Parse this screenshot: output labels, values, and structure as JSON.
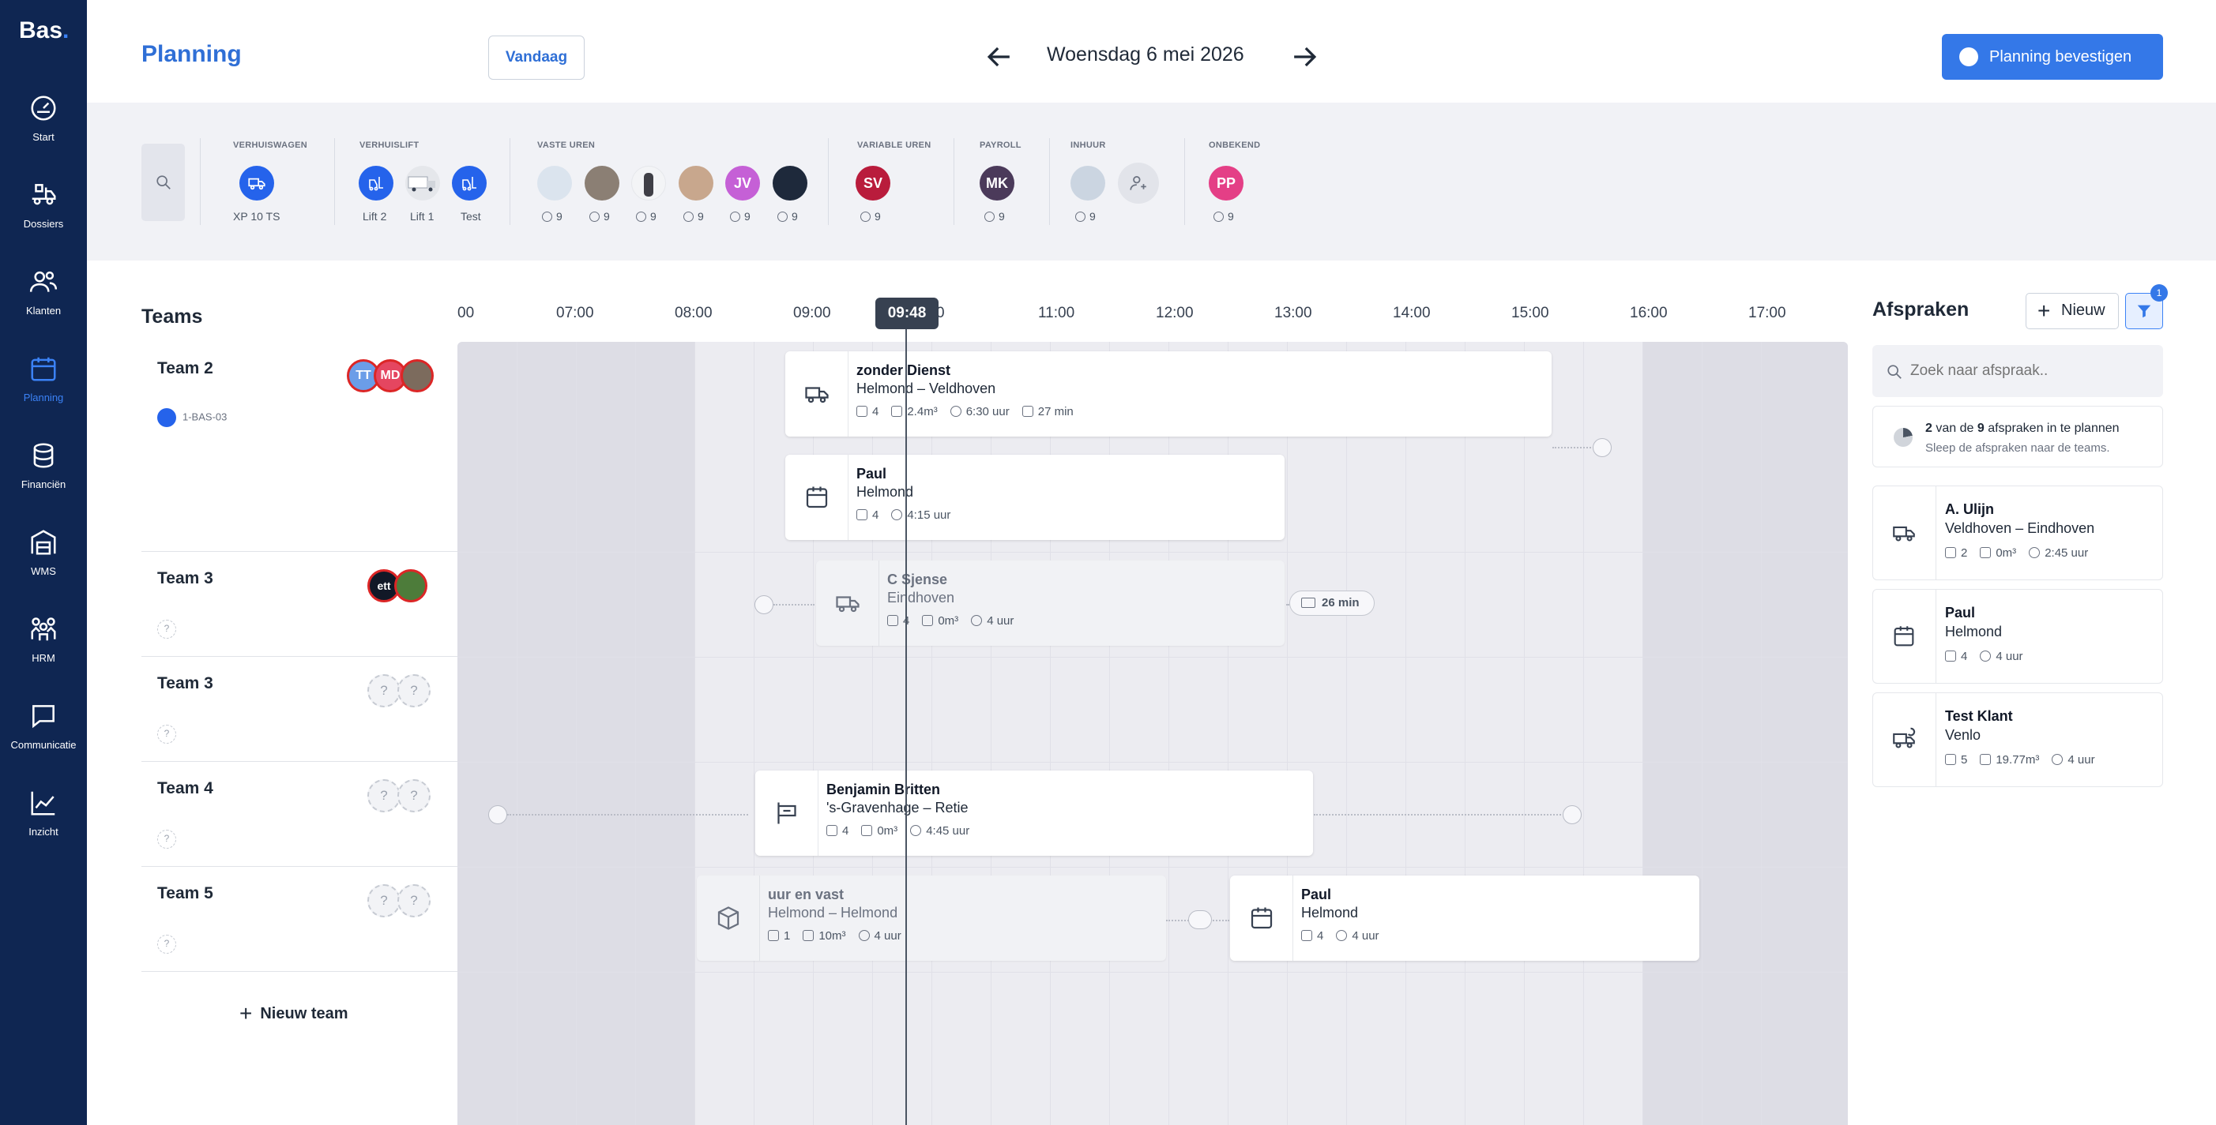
{
  "app": {
    "logo": "Bas",
    "logo_dot": "."
  },
  "sidebar": {
    "items": [
      {
        "label": "Start",
        "icon": "gauge-icon"
      },
      {
        "label": "Dossiers",
        "icon": "truck-boxes-icon"
      },
      {
        "label": "Klanten",
        "icon": "users-icon"
      },
      {
        "label": "Planning",
        "icon": "calendar-icon",
        "active": true
      },
      {
        "label": "Financiën",
        "icon": "coins-icon"
      },
      {
        "label": "WMS",
        "icon": "warehouse-icon"
      },
      {
        "label": "HRM",
        "icon": "people-group-icon"
      },
      {
        "label": "Communicatie",
        "icon": "chat-icon"
      },
      {
        "label": "Inzicht",
        "icon": "chart-line-icon"
      }
    ]
  },
  "header": {
    "title": "Planning",
    "today_label": "Vandaag",
    "date": "Woensdag 6 mei 2026",
    "confirm_label": "Planning bevestigen"
  },
  "resources": {
    "groups": [
      {
        "title": "VERHUISWAGEN",
        "items": [
          {
            "label": "XP 10 TS"
          }
        ]
      },
      {
        "title": "VERHUISLIFT",
        "items": [
          {
            "label": "Lift 2"
          },
          {
            "label": "Lift 1"
          },
          {
            "label": "Test"
          }
        ]
      },
      {
        "title": "VASTE UREN",
        "items": [
          {
            "hours": "9"
          },
          {
            "hours": "9"
          },
          {
            "hours": "9"
          },
          {
            "hours": "9"
          },
          {
            "initials": "JV",
            "hours": "9"
          },
          {
            "hours": "9"
          }
        ]
      },
      {
        "title": "VARIABLE UREN",
        "items": [
          {
            "initials": "SV",
            "hours": "9"
          }
        ]
      },
      {
        "title": "PAYROLL",
        "items": [
          {
            "initials": "MK",
            "hours": "9"
          }
        ]
      },
      {
        "title": "INHUUR",
        "items": [
          {
            "hours": "9"
          }
        ]
      },
      {
        "title": "ONBEKEND",
        "items": [
          {
            "initials": "PP",
            "hours": "9"
          }
        ]
      }
    ]
  },
  "teams": {
    "title": "Teams",
    "rows": [
      {
        "name": "Team 2",
        "vehicle": "1-BAS-03",
        "avatars": [
          "TT",
          "MD",
          ""
        ]
      },
      {
        "name": "Team 3",
        "avatars": [
          "ett",
          ""
        ],
        "unknown": "?"
      },
      {
        "name": "Team 3",
        "avatars": [
          "?",
          "?"
        ],
        "unknown": "?"
      },
      {
        "name": "Team 4",
        "avatars": [
          "?",
          "?"
        ],
        "unknown": "?"
      },
      {
        "name": "Team 5",
        "avatars": [
          "?",
          "?"
        ],
        "unknown": "?"
      }
    ],
    "new_team_label": "Nieuw team"
  },
  "timeline": {
    "ticks": [
      "00",
      "07:00",
      "08:00",
      "09:00",
      "0",
      "11:00",
      "12:00",
      "13:00",
      "14:00",
      "15:00",
      "16:00",
      "17:00"
    ],
    "now": "09:48",
    "travel_badge": "26 min"
  },
  "cards": [
    {
      "title": "zonder Dienst",
      "subtitle": "Helmond – Veldhoven",
      "people": "4",
      "volume": "2.4m³",
      "duration": "6:30 uur",
      "travel": "27 min"
    },
    {
      "title": "Paul",
      "subtitle": "Helmond",
      "people": "4",
      "duration": "4:15 uur"
    },
    {
      "title": "C Sjense",
      "subtitle": "Eindhoven",
      "people": "4",
      "volume": "0m³",
      "duration": "4 uur"
    },
    {
      "title": "Benjamin Britten",
      "subtitle": "'s-Gravenhage – Retie",
      "people": "4",
      "volume": "0m³",
      "duration": "4:45 uur"
    },
    {
      "title": "uur en vast",
      "subtitle": "Helmond – Helmond",
      "people": "1",
      "volume": "10m³",
      "duration": "4 uur"
    },
    {
      "title": "Paul",
      "subtitle": "Helmond",
      "people": "4",
      "duration": "4 uur"
    }
  ],
  "afspraken": {
    "title": "Afspraken",
    "new_label": "Nieuw",
    "filter_count": "1",
    "search_placeholder": "Zoek naar afspraak..",
    "info_count": "2",
    "info_mid": " van de ",
    "info_total": "9",
    "info_rest": " afspraken in te plannen",
    "info_sub": "Sleep de afspraken naar de teams.",
    "items": [
      {
        "title": "A. Ulijn",
        "subtitle": "Veldhoven – Eindhoven",
        "people": "2",
        "volume": "0m³",
        "duration": "2:45 uur"
      },
      {
        "title": "Paul",
        "subtitle": "Helmond",
        "people": "4",
        "duration": "4 uur"
      },
      {
        "title": "Test Klant",
        "subtitle": "Venlo",
        "people": "5",
        "volume": "19.77m³",
        "duration": "4 uur"
      }
    ]
  },
  "colors": {
    "sidebar": "#0f2652",
    "accent": "#3478e8",
    "grid": "#ececf1",
    "offhours": "#dddde5"
  }
}
